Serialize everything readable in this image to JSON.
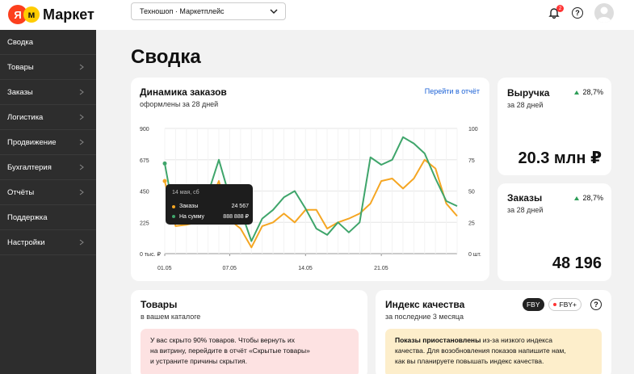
{
  "header": {
    "logo_text": "Маркет",
    "shop_selector": "Техношоп · Маркетплейс",
    "notifications_count": "2"
  },
  "sidebar": {
    "items": [
      {
        "label": "Сводка",
        "has_arrow": false
      },
      {
        "label": "Товары",
        "has_arrow": true
      },
      {
        "label": "Заказы",
        "has_arrow": true
      },
      {
        "label": "Логистика",
        "has_arrow": true
      },
      {
        "label": "Продвижение",
        "has_arrow": true
      },
      {
        "label": "Бухгалтерия",
        "has_arrow": true
      },
      {
        "label": "Отчёты",
        "has_arrow": true
      },
      {
        "label": "Поддержка",
        "has_arrow": false
      },
      {
        "label": "Настройки",
        "has_arrow": true
      }
    ]
  },
  "page": {
    "title": "Сводка"
  },
  "orders_chart": {
    "title": "Динамика заказов",
    "subtitle": "оформлены за 28 дней",
    "link": "Перейти в отчёт",
    "tooltip": {
      "date": "14 мая, сб",
      "rows": [
        {
          "label": "Заказы",
          "value": "24 567",
          "color": "#f5a623"
        },
        {
          "label": "На сумму",
          "value": "888 888 ₽",
          "color": "#3fa56b"
        }
      ]
    }
  },
  "chart_data": {
    "type": "line",
    "x_tick_labels": [
      "01.05",
      "07.05",
      "14.05",
      "21.05"
    ],
    "x": [
      1,
      2,
      3,
      4,
      5,
      6,
      7,
      8,
      9,
      10,
      11,
      12,
      13,
      14,
      15,
      16,
      17,
      18,
      19,
      20,
      21,
      22,
      23,
      24,
      25,
      26,
      27
    ],
    "y_left_ticks": [
      "900",
      "675",
      "450",
      "225",
      "0 тыс. ₽"
    ],
    "y_right_ticks": [
      "100",
      "75",
      "50",
      "25",
      "0 шт."
    ],
    "y_left_range": [
      0,
      900
    ],
    "y_right_range": [
      0,
      100
    ],
    "series": [
      {
        "name": "Заказы",
        "color": "#f5a623",
        "axis": "right",
        "values": [
          58,
          22,
          23,
          25,
          38,
          58,
          27,
          20,
          5,
          22,
          25,
          32,
          25,
          35,
          35,
          20,
          25,
          28,
          32,
          40,
          58,
          60,
          52,
          60,
          75,
          68,
          40,
          30
        ]
      },
      {
        "name": "На сумму",
        "color": "#3fa56b",
        "axis": "right",
        "values": [
          72,
          25,
          28,
          30,
          48,
          75,
          45,
          35,
          10,
          28,
          35,
          45,
          50,
          36,
          20,
          15,
          25,
          17,
          25,
          77,
          71,
          75,
          93,
          88,
          80,
          60,
          42,
          38
        ]
      }
    ],
    "grid": true,
    "legend": "none"
  },
  "kpis": [
    {
      "title": "Выручка",
      "subtitle": "за 28 дней",
      "change": "28,7%",
      "value": "20.3 млн ₽"
    },
    {
      "title": "Заказы",
      "subtitle": "за 28 дней",
      "change": "28,7%",
      "value": "48 196"
    }
  ],
  "goods_card": {
    "title": "Товары",
    "subtitle": "в вашем каталоге",
    "notice_lines": [
      "У вас скрыто 90% товаров. Чтобы вернуть их",
      "на витрину, перейдите в отчёт «Скрытые товары»",
      "и устраните причины скрытия."
    ],
    "notice_color": "#fde2e2"
  },
  "quality_card": {
    "title": "Индекс качества",
    "subtitle": "за последние 3 месяца",
    "chip_active": "FBY",
    "chip_inactive": "FBY+",
    "notice_bold": "Показы приостановлены",
    "notice_rest_1": " из-за низкого индекса",
    "notice_line_2": "качества. Для возобновления показов напишите нам,",
    "notice_line_3": "как вы планируете повышать индекс качества.",
    "notice_color": "#fdeecb"
  }
}
